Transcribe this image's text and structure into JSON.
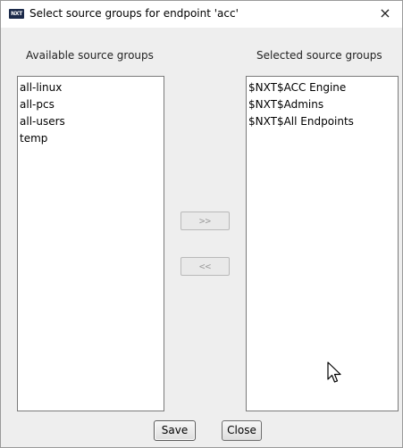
{
  "window": {
    "title": "Select source groups for endpoint 'acc'",
    "app_icon_text": "NXT",
    "close_glyph": "×"
  },
  "available": {
    "label": "Available source groups",
    "items": [
      "all-linux",
      "all-pcs",
      "all-users",
      "temp"
    ]
  },
  "selected": {
    "label": "Selected source groups",
    "items": [
      "$NXT$ACC Engine",
      "$NXT$Admins",
      "$NXT$All Endpoints"
    ]
  },
  "move_buttons": {
    "add_label": ">>",
    "remove_label": "<<"
  },
  "footer": {
    "save_label": "Save",
    "close_label": "Close"
  },
  "colors": {
    "dialog_bg": "#eeeeee",
    "list_bg": "#ffffff",
    "disabled_text": "#9c9c9c"
  }
}
